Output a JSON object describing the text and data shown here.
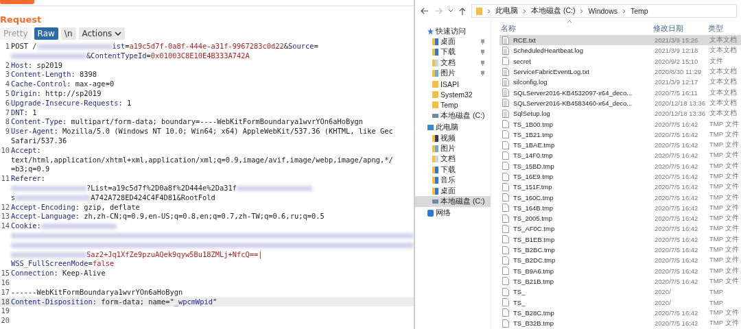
{
  "request": {
    "title": "Request",
    "view_tabs": [
      {
        "label": "Pretty",
        "selected": false
      },
      {
        "label": "Raw",
        "selected": true
      },
      {
        "label": "\\n",
        "selected": false
      }
    ],
    "actions": "Actions",
    "lines": [
      {
        "num": "1",
        "current": false,
        "rows": [
          {
            "parts": [
              {
                "kind": "val",
                "text": "POST /"
              },
              {
                "kind": "blur"
              },
              {
                "kind": "key",
                "text": "ist"
              },
              {
                "kind": "val",
                "text": "="
              },
              {
                "kind": "param",
                "text": "a19c5d7f-0a8f-444e-a31f-9967283c0d22"
              },
              {
                "kind": "val",
                "text": "&"
              },
              {
                "kind": "key",
                "text": "Source"
              },
              {
                "kind": "val",
                "text": "="
              }
            ]
          },
          {
            "parts": [
              {
                "kind": "blur"
              },
              {
                "kind": "val",
                "text": "&"
              },
              {
                "kind": "key",
                "text": "ContentTypeId"
              },
              {
                "kind": "val",
                "text": "="
              },
              {
                "kind": "param",
                "text": "0x01003C8E10E4B333A742A"
              }
            ]
          }
        ]
      },
      {
        "num": "2",
        "current": false,
        "rows": [
          {
            "parts": [
              {
                "kind": "key",
                "text": "Host"
              },
              {
                "kind": "val",
                "text": ": sp2019"
              }
            ]
          }
        ]
      },
      {
        "num": "3",
        "current": false,
        "rows": [
          {
            "parts": [
              {
                "kind": "key",
                "text": "Content-Length"
              },
              {
                "kind": "val",
                "text": ": 8398"
              }
            ]
          }
        ]
      },
      {
        "num": "4",
        "current": false,
        "rows": [
          {
            "parts": [
              {
                "kind": "key",
                "text": "Cache-Control"
              },
              {
                "kind": "val",
                "text": ": max-age=0"
              }
            ]
          }
        ]
      },
      {
        "num": "5",
        "current": false,
        "rows": [
          {
            "parts": [
              {
                "kind": "key",
                "text": "Origin"
              },
              {
                "kind": "val",
                "text": ": http://sp2019"
              }
            ]
          }
        ]
      },
      {
        "num": "6",
        "current": false,
        "rows": [
          {
            "parts": [
              {
                "kind": "key",
                "text": "Upgrade-Insecure-Requests"
              },
              {
                "kind": "val",
                "text": ": 1"
              }
            ]
          }
        ]
      },
      {
        "num": "7",
        "current": false,
        "rows": [
          {
            "parts": [
              {
                "kind": "key",
                "text": "DNT"
              },
              {
                "kind": "val",
                "text": ": 1"
              }
            ]
          }
        ]
      },
      {
        "num": "8",
        "current": false,
        "rows": [
          {
            "parts": [
              {
                "kind": "key",
                "text": "Content-Type"
              },
              {
                "kind": "val",
                "text": ": multipart/form-data; boundary=----WebKitFormBoundarya1wvrYOn6aHoBygn"
              }
            ]
          }
        ]
      },
      {
        "num": "9",
        "current": false,
        "rows": [
          {
            "parts": [
              {
                "kind": "key",
                "text": "User-Agent"
              },
              {
                "kind": "val",
                "text": ": Mozilla/5.0 (Windows NT 10.0; Win64; x64) AppleWebKit/537.36 (KHTML, like Gec"
              }
            ]
          },
          {
            "parts": [
              {
                "kind": "val",
                "text": "Safari/537.36"
              }
            ]
          }
        ]
      },
      {
        "num": "10",
        "current": false,
        "rows": [
          {
            "parts": [
              {
                "kind": "key",
                "text": "Accept"
              },
              {
                "kind": "val",
                "text": ":"
              }
            ]
          },
          {
            "parts": [
              {
                "kind": "val",
                "text": "text/html,application/xhtml+xml,application/xml;q=0.9,image/avif,image/webp,image/apng,*/"
              }
            ]
          },
          {
            "parts": [
              {
                "kind": "val",
                "text": "=b3;q=0.9"
              }
            ]
          }
        ]
      },
      {
        "num": "11",
        "current": false,
        "rows": [
          {
            "parts": [
              {
                "kind": "key",
                "text": "Referer"
              },
              {
                "kind": "val",
                "text": ":"
              }
            ]
          },
          {
            "parts": [
              {
                "kind": "blur"
              },
              {
                "kind": "val",
                "text": "?List=a19c5d7f%2D0a8f%2D444e%2Da31f"
              },
              {
                "kind": "blur"
              }
            ]
          },
          {
            "parts": [
              {
                "kind": "val",
                "text": "s"
              },
              {
                "kind": "blur"
              },
              {
                "kind": "val",
                "text": "A742A728ED424C4F4D81&RootFold"
              }
            ]
          }
        ]
      },
      {
        "num": "12",
        "current": false,
        "rows": [
          {
            "parts": [
              {
                "kind": "key",
                "text": "Accept-Encoding"
              },
              {
                "kind": "val",
                "text": ": gzip, deflate"
              }
            ]
          }
        ]
      },
      {
        "num": "13",
        "current": false,
        "rows": [
          {
            "parts": [
              {
                "kind": "key",
                "text": "Accept-Language"
              },
              {
                "kind": "val",
                "text": ": zh,zh-CN;q=0.9,en-US;q=0.8,en;q=0.7,zh-TW;q=0.6,ru;q=0.5"
              }
            ]
          }
        ]
      },
      {
        "num": "14",
        "current": false,
        "rows": [
          {
            "parts": [
              {
                "kind": "key",
                "text": "Cookie"
              },
              {
                "kind": "val",
                "text": ":"
              },
              {
                "kind": "blur"
              }
            ]
          },
          {
            "parts": [
              {
                "kind": "blur"
              }
            ]
          },
          {
            "parts": [
              {
                "kind": "blur"
              }
            ]
          },
          {
            "parts": [
              {
                "kind": "blur"
              },
              {
                "kind": "param",
                "text": "Saz2+Jq1XfZe9pzuAQek9qyw5Bu18ZMLj+NfcQ==|"
              }
            ]
          },
          {
            "parts": [
              {
                "kind": "key",
                "text": "WSS_FullScreenMode"
              },
              {
                "kind": "val",
                "text": "="
              },
              {
                "kind": "param",
                "text": "false"
              }
            ]
          }
        ]
      },
      {
        "num": "15",
        "current": false,
        "rows": [
          {
            "parts": [
              {
                "kind": "key",
                "text": "Connection"
              },
              {
                "kind": "val",
                "text": ": Keep-Alive"
              }
            ]
          }
        ]
      },
      {
        "num": "16",
        "current": false
      },
      {
        "num": "17",
        "current": false,
        "rows": [
          {
            "parts": [
              {
                "kind": "val",
                "text": "------WebKitFormBoundarya1wvrYOn6aHoBygn"
              }
            ]
          }
        ]
      },
      {
        "num": "18",
        "current": true,
        "rows": [
          {
            "parts": [
              {
                "kind": "key",
                "text": "Content-Disposition"
              },
              {
                "kind": "val",
                "text": ": form-data; name=\""
              },
              {
                "kind": "key",
                "text": "_wpcmWpid"
              },
              {
                "kind": "val",
                "text": "\""
              }
            ]
          }
        ]
      },
      {
        "num": "19",
        "current": false
      },
      {
        "num": "20",
        "current": false
      }
    ]
  },
  "explorer": {
    "breadcrumbs": [
      "此电脑",
      "本地磁盘 (C:)",
      "Windows",
      "Temp"
    ],
    "nav": [
      {
        "label": "快速访问",
        "kind": "star",
        "selected": false,
        "children": [
          {
            "label": "桌面",
            "kind": "desktop",
            "pinned": true,
            "selected": false
          },
          {
            "label": "下载",
            "kind": "download",
            "pinned": true,
            "selected": false
          },
          {
            "label": "文档",
            "kind": "docs",
            "pinned": true,
            "selected": false
          },
          {
            "label": "图片",
            "kind": "pictures",
            "pinned": true,
            "selected": false
          },
          {
            "label": "ISAPI",
            "kind": "folder",
            "pinned": false,
            "selected": false
          },
          {
            "label": "System32",
            "kind": "folder",
            "pinned": false,
            "selected": false
          },
          {
            "label": "Temp",
            "kind": "folder",
            "pinned": false,
            "selected": false
          },
          {
            "label": "本地磁盘 (C:)",
            "kind": "drive",
            "pinned": false,
            "selected": false
          }
        ]
      },
      {
        "label": "此电脑",
        "kind": "pc",
        "selected": false,
        "children": [
          {
            "label": "视频",
            "kind": "video",
            "selected": false
          },
          {
            "label": "图片",
            "kind": "pictures",
            "selected": false
          },
          {
            "label": "文档",
            "kind": "docs",
            "selected": false
          },
          {
            "label": "下载",
            "kind": "download",
            "selected": false
          },
          {
            "label": "音乐",
            "kind": "music",
            "selected": false
          },
          {
            "label": "桌面",
            "kind": "desktop",
            "selected": false
          },
          {
            "label": "本地磁盘 (C:)",
            "kind": "drive",
            "selected": true
          }
        ]
      },
      {
        "label": "网络",
        "kind": "network",
        "selected": false
      }
    ],
    "columns": [
      "名称",
      "修改日期",
      "类型"
    ],
    "files": [
      {
        "name": "RCE.txt",
        "date": "2021/3/9 15:26",
        "type": "文本文档",
        "kind": "text",
        "selected": true
      },
      {
        "name": "ScheduledHeartbeat.log",
        "date": "2021/3/9 12:18",
        "type": "文本文档",
        "kind": "text",
        "selected": false
      },
      {
        "name": "secret",
        "date": "2020/9/2 15:10",
        "type": "文件",
        "kind": "file",
        "selected": false
      },
      {
        "name": "ServiceFabricEventLog.txt",
        "date": "2020/8/30 11:29",
        "type": "文本文档",
        "kind": "text",
        "selected": false
      },
      {
        "name": "silconfig.log",
        "date": "2021/3/9 12:17",
        "type": "文本文档",
        "kind": "text",
        "selected": false
      },
      {
        "name": "SQLServer2016-KB4532097-x64_deco...",
        "date": "2020/7/5 16:11",
        "type": "文本文档",
        "kind": "text",
        "selected": false
      },
      {
        "name": "SQLServer2016-KB4583460-x64_deco...",
        "date": "2020/12/18 13:36",
        "type": "文本文档",
        "kind": "text",
        "selected": false
      },
      {
        "name": "SqlSetup.log",
        "date": "2020/12/18 13:36",
        "type": "文本文档",
        "kind": "text",
        "selected": false
      },
      {
        "name": "TS_1B00.tmp",
        "date": "2020/7/5 16:42",
        "type": "TMP 文件",
        "kind": "file",
        "selected": false
      },
      {
        "name": "TS_1B21.tmp",
        "date": "2020/7/5 16:42",
        "type": "TMP 文件",
        "kind": "file",
        "selected": false
      },
      {
        "name": "TS_1BAE.tmp",
        "date": "2020/7/5 16:42",
        "type": "TMP 文件",
        "kind": "file",
        "selected": false
      },
      {
        "name": "TS_14F0.tmp",
        "date": "2020/7/5 16:42",
        "type": "TMP 文件",
        "kind": "file",
        "selected": false
      },
      {
        "name": "TS_15BD.tmp",
        "date": "2020/7/5 16:42",
        "type": "TMP 文件",
        "kind": "file",
        "selected": false
      },
      {
        "name": "TS_16E9.tmp",
        "date": "2020/7/5 16:42",
        "type": "TMP 文件",
        "kind": "file",
        "selected": false
      },
      {
        "name": "TS_151F.tmp",
        "date": "2020/7/5 16:42",
        "type": "TMP 文件",
        "kind": "file",
        "selected": false
      },
      {
        "name": "TS_160C.tmp",
        "date": "2020/7/5 16:42",
        "type": "TMP 文件",
        "kind": "file",
        "selected": false
      },
      {
        "name": "TS_164B.tmp",
        "date": "2020/7/5 16:42",
        "type": "TMP 文件",
        "kind": "file",
        "selected": false
      },
      {
        "name": "TS_2005.tmp",
        "date": "2020/7/5 16:42",
        "type": "TMP 文件",
        "kind": "file",
        "selected": false
      },
      {
        "name": "TS_AF0C.tmp",
        "date": "2020/7/5 16:42",
        "type": "TMP 文件",
        "kind": "file",
        "selected": false
      },
      {
        "name": "TS_B1EB.tmp",
        "date": "2020/7/5 16:42",
        "type": "TMP 文件",
        "kind": "file",
        "selected": false
      },
      {
        "name": "TS_B2BC.tmp",
        "date": "2020/7/5 16:42",
        "type": "TMP 文件",
        "kind": "file",
        "selected": false
      },
      {
        "name": "TS_B2DC.tmp",
        "date": "2020/7/5 16:42",
        "type": "TMP 文件",
        "kind": "file",
        "selected": false
      },
      {
        "name": "TS_B9A6.tmp",
        "date": "2020/7/5 16:42",
        "type": "TMP 文件",
        "kind": "file",
        "selected": false
      },
      {
        "name": "TS_B21B.tmp",
        "date": "2020/7/5 16:42",
        "type": "TMP 文件",
        "kind": "file",
        "selected": false
      },
      {
        "name": "TS_",
        "date": "2020/",
        "type": "TMP",
        "kind": "file",
        "selected": false
      },
      {
        "name": "TS_",
        "date": "2020/",
        "type": "TMP",
        "kind": "file",
        "selected": false
      },
      {
        "name": "TS_B28C.tmp",
        "date": "2020/7/5 16:42",
        "type": "TMP 文件",
        "kind": "file",
        "selected": false
      },
      {
        "name": "TS_B32B.tmp",
        "date": "2020/7/5 16:42",
        "type": "TMP 文件",
        "kind": "file",
        "selected": false
      }
    ]
  }
}
